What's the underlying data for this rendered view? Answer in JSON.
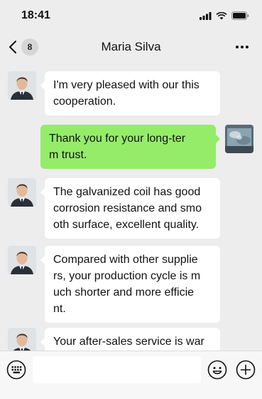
{
  "status_bar": {
    "time": "18:41"
  },
  "nav": {
    "unread_count": "8",
    "title": "Maria Silva"
  },
  "messages": [
    {
      "side": "in",
      "text": "I'm very pleased with our this\ncooperation."
    },
    {
      "side": "out",
      "text": "Thank you for your long-ter\nm trust."
    },
    {
      "side": "in",
      "text": "The galvanized coil has good\ncorrosion resistance and smo\noth surface, excellent quality."
    },
    {
      "side": "in",
      "text": "Compared with other supplie\nrs, your production cycle is m\nuch shorter and more efficie\nnt."
    },
    {
      "side": "in",
      "text": "Your after-sales service is war"
    }
  ],
  "input": {
    "placeholder": ""
  },
  "colors": {
    "incoming": "#ffffff",
    "outgoing": "#95ec69",
    "background": "#ededed"
  }
}
